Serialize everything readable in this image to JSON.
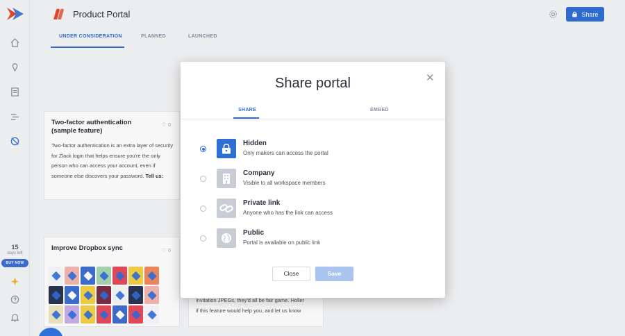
{
  "header": {
    "title": "Product Portal",
    "share_label": "Share"
  },
  "tabs": [
    {
      "label": "UNDER CONSIDERATION",
      "active": true
    },
    {
      "label": "PLANNED",
      "active": false
    },
    {
      "label": "LAUNCHED",
      "active": false
    }
  ],
  "trial": {
    "days": "15",
    "days_label": "days left",
    "buy_label": "BUY NOW"
  },
  "cards": [
    {
      "title_line1": "Two-factor authentication",
      "title_line2": "(sample feature)",
      "votes": "0",
      "body": "Two-factor authentication is an extra layer of security for Zlack login that helps ensure you're the only person who can access your account, even if someone else discovers your password.",
      "body_bold": "Tell us:"
    },
    {
      "title": "Improve Dropbox sync",
      "votes": "0"
    }
  ],
  "behind_text": {
    "line1": "invitation JPEGs, they'd all be fair game. Holler",
    "line2": "if this feature would help you, and let us know"
  },
  "modal": {
    "title": "Share portal",
    "tabs": [
      {
        "label": "SHARE",
        "active": true
      },
      {
        "label": "EMBED",
        "active": false
      }
    ],
    "options": [
      {
        "title": "Hidden",
        "desc": "Only makers can access the portal",
        "selected": true,
        "icon": "lock-icon"
      },
      {
        "title": "Company",
        "desc": "Visible to all workspace members",
        "selected": false,
        "icon": "building-icon"
      },
      {
        "title": "Private link",
        "desc": "Anyone who has the link can access",
        "selected": false,
        "icon": "link-icon"
      },
      {
        "title": "Public",
        "desc": "Portal is available on public link",
        "selected": false,
        "icon": "globe-icon"
      }
    ],
    "close_label": "Close",
    "save_label": "Save"
  },
  "colors": {
    "accent": "#2f6fd4",
    "save_disabled": "#a9c4ef",
    "buy_now": "#3f6fd1"
  }
}
